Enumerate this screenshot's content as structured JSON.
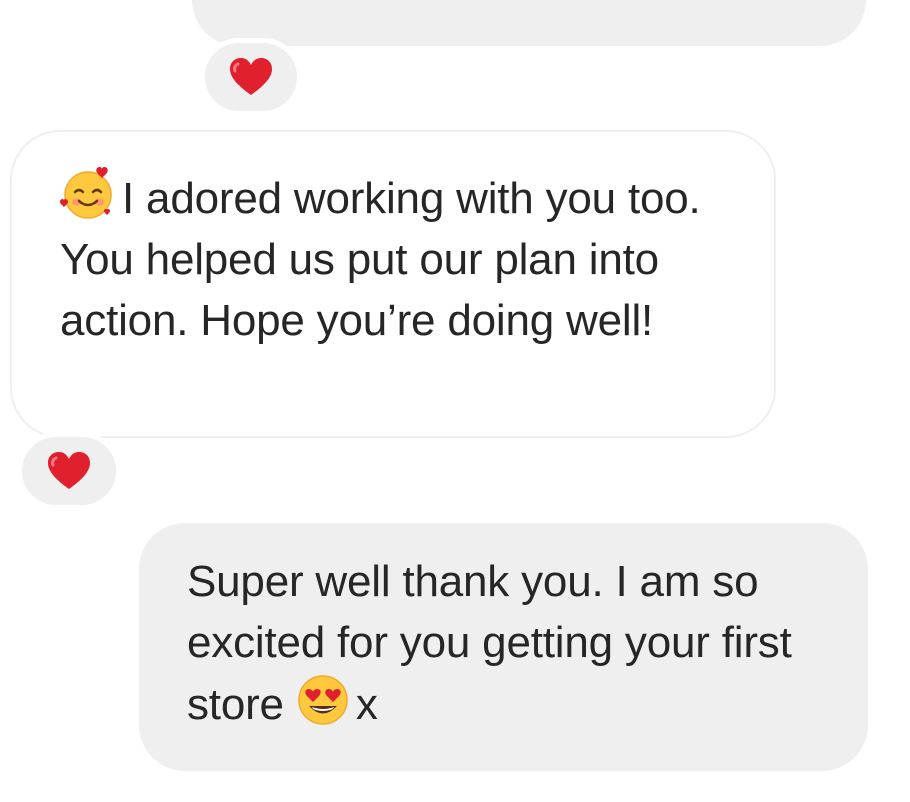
{
  "messages": [
    {
      "id": "outgoing-cutoff",
      "direction": "outgoing",
      "text": "",
      "reaction": "heart"
    },
    {
      "id": "incoming-1",
      "direction": "incoming",
      "leading_emoji": "smiling-face-with-hearts",
      "text": "I adored working with you too. You helped us put our plan into action. Hope you’re doing well!",
      "reaction": "heart"
    },
    {
      "id": "outgoing-1",
      "direction": "outgoing",
      "text_before_emoji": "Super well thank you. I am so excited for you getting your first store",
      "trailing_emoji": "heart-eyes",
      "text_after_emoji": "x"
    }
  ],
  "colors": {
    "outgoing_bubble": "#efefef",
    "incoming_border": "#efefef",
    "text": "#262626",
    "heart": "#e0202c"
  }
}
